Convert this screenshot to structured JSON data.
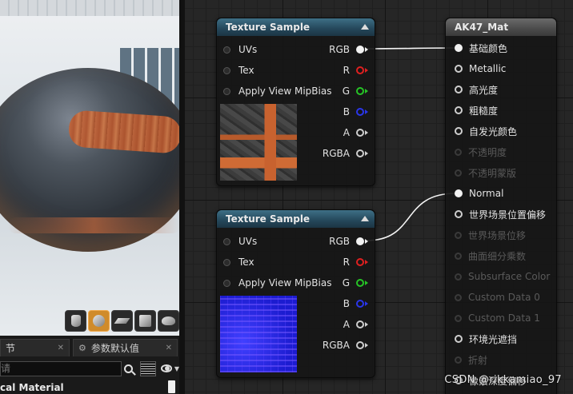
{
  "details": {
    "tabs": [
      {
        "label": "节",
        "close": "✕"
      },
      {
        "label": "参数默认值",
        "close": "✕"
      }
    ],
    "search_placeholder": "请",
    "category": "cal Material"
  },
  "graph": {
    "texture_nodes": [
      {
        "title": "Texture Sample",
        "inputs": [
          "UVs",
          "Tex",
          "Apply View MipBias"
        ],
        "outputs": [
          "RGB",
          "R",
          "G",
          "B",
          "A",
          "RGBA"
        ]
      },
      {
        "title": "Texture Sample",
        "inputs": [
          "UVs",
          "Tex",
          "Apply View MipBias"
        ],
        "outputs": [
          "RGB",
          "R",
          "G",
          "B",
          "A",
          "RGBA"
        ]
      }
    ],
    "material_node": {
      "title": "AK47_Mat",
      "pins": [
        {
          "label": "基础颜色",
          "active": true,
          "connected": true
        },
        {
          "label": "Metallic",
          "active": true,
          "connected": false
        },
        {
          "label": "高光度",
          "active": true,
          "connected": false
        },
        {
          "label": "粗糙度",
          "active": true,
          "connected": false
        },
        {
          "label": "自发光颜色",
          "active": true,
          "connected": false
        },
        {
          "label": "不透明度",
          "active": false,
          "connected": false
        },
        {
          "label": "不透明蒙版",
          "active": false,
          "connected": false
        },
        {
          "label": "Normal",
          "active": true,
          "connected": true
        },
        {
          "label": "世界场景位置偏移",
          "active": true,
          "connected": false
        },
        {
          "label": "世界场景位移",
          "active": false,
          "connected": false
        },
        {
          "label": "曲面细分乘数",
          "active": false,
          "connected": false
        },
        {
          "label": "Subsurface Color",
          "active": false,
          "connected": false
        },
        {
          "label": "Custom Data 0",
          "active": false,
          "connected": false
        },
        {
          "label": "Custom Data 1",
          "active": false,
          "connected": false
        },
        {
          "label": "环境光遮挡",
          "active": true,
          "connected": false
        },
        {
          "label": "折射",
          "active": false,
          "connected": false
        },
        {
          "label": "像素深度偏移",
          "active": true,
          "connected": false
        }
      ]
    },
    "watermark": "CSDN @rikkamiao_97"
  },
  "colors": {
    "texture_header": "#2f5b70",
    "material_header": "#555555",
    "pin_r": "#e02020",
    "pin_g": "#26c426",
    "pin_b": "#2a36ea",
    "viewport_toolbar_active": "#d08b2a"
  },
  "icons": {
    "viewport_toolbar": [
      "cylinder-preview-icon",
      "sphere-preview-icon",
      "plane-preview-icon",
      "cube-preview-icon",
      "teapot-preview-icon"
    ],
    "details": [
      "search-icon",
      "grid-view-icon",
      "eye-icon"
    ]
  }
}
